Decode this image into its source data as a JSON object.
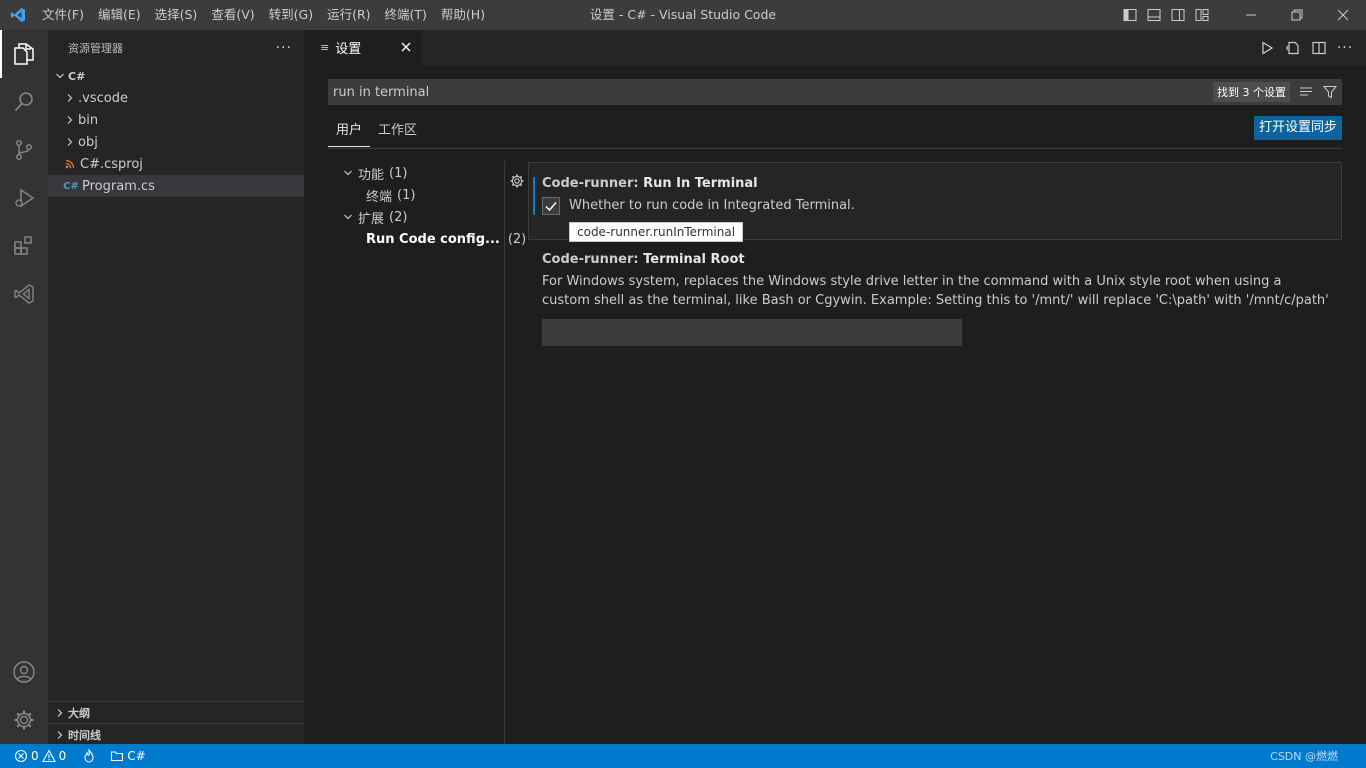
{
  "window": {
    "title": "设置 - C# - Visual Studio Code",
    "menu": [
      "文件(F)",
      "编辑(E)",
      "选择(S)",
      "查看(V)",
      "转到(G)",
      "运行(R)",
      "终端(T)",
      "帮助(H)"
    ]
  },
  "sidebar": {
    "title": "资源管理器",
    "more": "···",
    "root": "C#",
    "items": [
      {
        "label": ".vscode"
      },
      {
        "label": "bin"
      },
      {
        "label": "obj"
      },
      {
        "label": "C#.csproj"
      },
      {
        "label": "Program.cs",
        "icon": "C#"
      }
    ],
    "outline": "大纲",
    "timeline": "时间线"
  },
  "editor": {
    "tab": {
      "label": "设置",
      "icon": "≡"
    }
  },
  "settings": {
    "search_value": "run in terminal",
    "result_count": "找到 3 个设置",
    "scopes": [
      "用户",
      "工作区"
    ],
    "sync_button": "打开设置同步",
    "toc": [
      {
        "label": "功能",
        "count": "(1)"
      },
      {
        "label": "终端",
        "count": "(1)"
      },
      {
        "label": "扩展",
        "count": "(2)"
      },
      {
        "label": "Run Code config...",
        "count": "(2)"
      }
    ],
    "items": [
      {
        "category": "Code-runner: ",
        "key": "Run In Terminal",
        "description": "Whether to run code in Integrated Terminal.",
        "checked": true,
        "tooltip": "code-runner.runInTerminal"
      },
      {
        "category": "Code-runner: ",
        "key": "Terminal Root",
        "description": "For Windows system, replaces the Windows style drive letter in the command with a Unix style root when using a custom shell as the terminal, like Bash or Cgywin. Example: Setting this to '/mnt/' will replace 'C:\\path' with '/mnt/c/path'",
        "value": ""
      }
    ]
  },
  "statusbar": {
    "errors": "0",
    "warnings": "0",
    "folder": "C#",
    "watermark": "CSDN @燃燃"
  },
  "colors": {
    "accent": "#007acc",
    "button": "#0e639c",
    "editor_bg": "#1e1e1e",
    "sidebar_bg": "#252526"
  }
}
